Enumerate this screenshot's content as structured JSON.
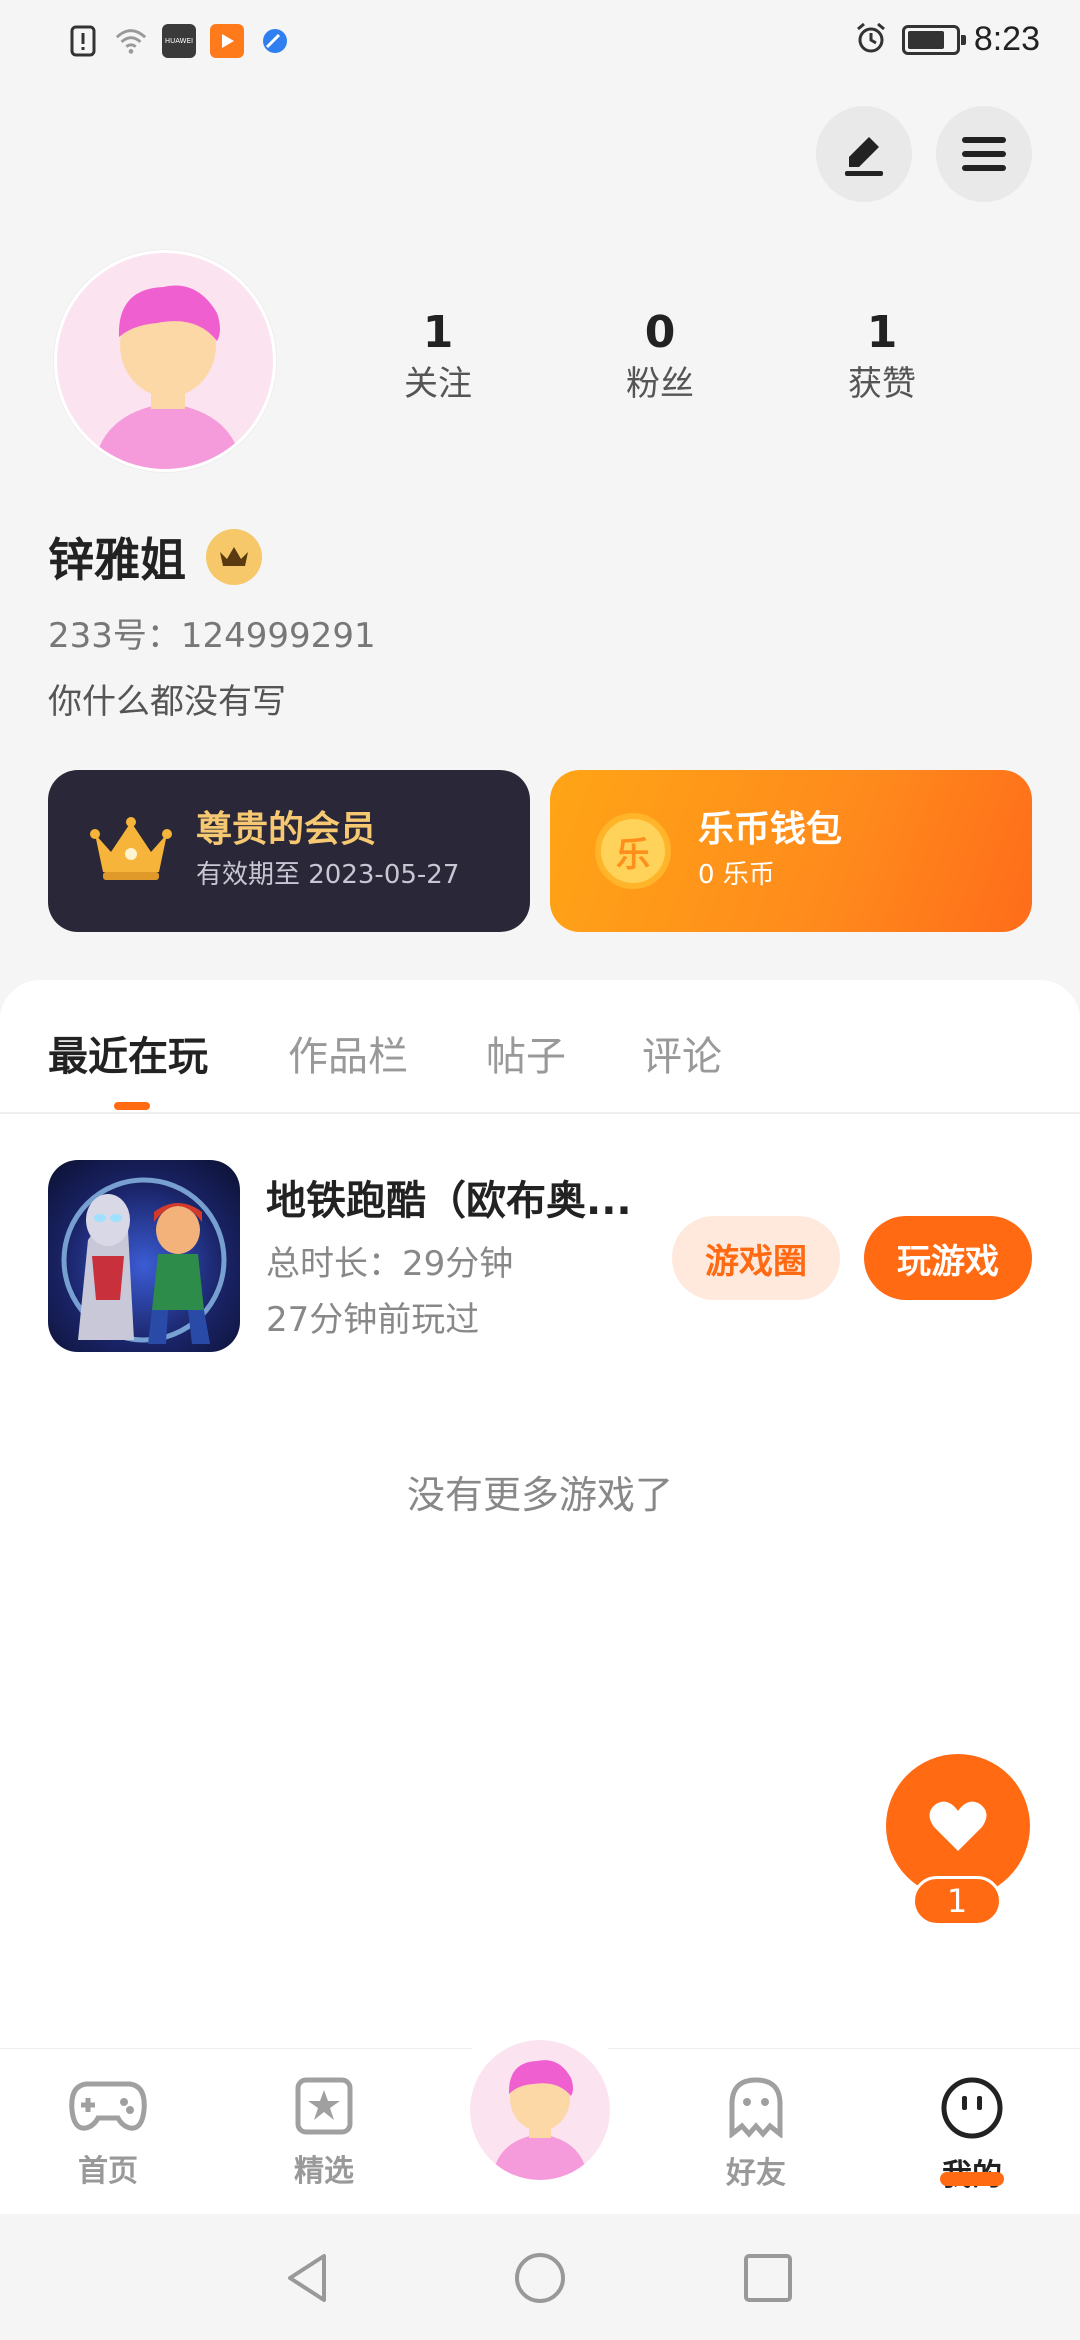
{
  "status_bar": {
    "time": "8:23",
    "left_icons": [
      "alert-icon",
      "wifi-icon",
      "huawei-store-icon",
      "video-app-icon",
      "browser-icon"
    ],
    "right_icons": [
      "alarm-icon",
      "battery-icon"
    ],
    "huawei_label": "HUAWEI"
  },
  "header": {
    "actions": [
      "edit-icon",
      "menu-icon"
    ]
  },
  "profile": {
    "username": "锌雅姐",
    "user_id": "233号：124999291",
    "bio": "你什么都没有写",
    "stats": [
      {
        "value": "1",
        "label": "关注"
      },
      {
        "value": "0",
        "label": "粉丝"
      },
      {
        "value": "1",
        "label": "获赞"
      }
    ]
  },
  "cards": {
    "vip": {
      "title": "尊贵的会员",
      "subtitle": "有效期至 2023-05-27"
    },
    "wallet": {
      "title": "乐币钱包",
      "subtitle": "0 乐币",
      "coin_glyph": "乐"
    }
  },
  "tabs": [
    {
      "label": "最近在玩",
      "active": true
    },
    {
      "label": "作品栏",
      "active": false
    },
    {
      "label": "帖子",
      "active": false
    },
    {
      "label": "评论",
      "active": false
    }
  ],
  "recent_game": {
    "title": "地铁跑酷（欧布奥...",
    "duration": "总时长：29分钟",
    "last_played": "27分钟前玩过",
    "circle_button": "游戏圈",
    "play_button": "玩游戏"
  },
  "empty_text": "没有更多游戏了",
  "fab": {
    "badge": "1"
  },
  "bottom_nav": [
    {
      "label": "首页",
      "icon": "gamepad-icon",
      "active": false
    },
    {
      "label": "精选",
      "icon": "star-bookmark-icon",
      "active": false
    },
    {
      "label": "",
      "icon": "avatar-center",
      "active": false
    },
    {
      "label": "好友",
      "icon": "ghost-icon",
      "active": false
    },
    {
      "label": "我的",
      "icon": "smiley-icon",
      "active": true
    }
  ],
  "colors": {
    "accent": "#ff6a13",
    "vip_card": "#2a2838",
    "vip_gold": "#f7c872",
    "wallet_start": "#ffa516",
    "wallet_end": "#ff6c1a"
  }
}
